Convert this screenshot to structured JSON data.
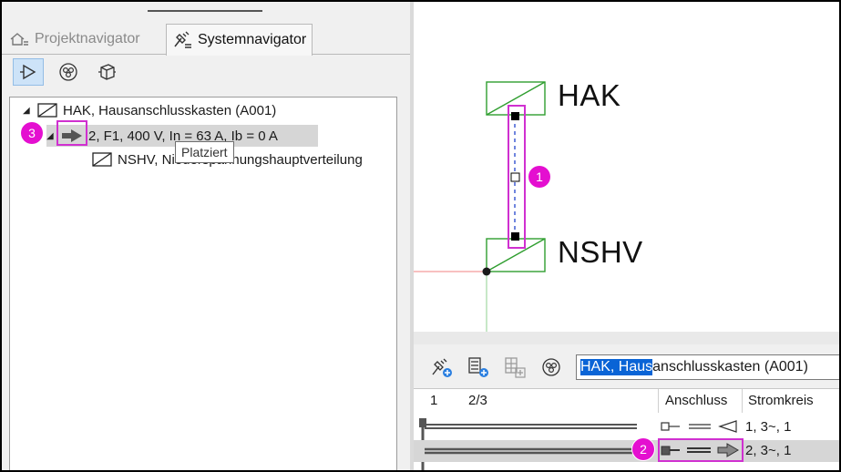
{
  "tabs": {
    "projektnavigator": "Projektnavigator",
    "systemnavigator": "Systemnavigator"
  },
  "toolbar": {
    "icons": [
      "play-outline-icon",
      "circuit-circles-icon",
      "cube-icon"
    ]
  },
  "tree": {
    "items": [
      {
        "label": "HAK, Hausanschlusskasten (A001)",
        "icon": "distribution-box-icon"
      },
      {
        "label": "2, F1, 400 V, In = 63 A, Ib = 0 A",
        "icon": "connection-arrow-icon"
      },
      {
        "label": "NSHV, Niederspannungshauptverteilung",
        "icon": "distribution-box-icon"
      }
    ],
    "tooltip": "Platziert"
  },
  "markers": {
    "m1": "1",
    "m2": "2",
    "m3": "3"
  },
  "canvas": {
    "top_label": "HAK",
    "bottom_label": "NSHV"
  },
  "bottom": {
    "search_selected": "HAK, Haus",
    "search_rest": "anschlusskasten (A001)",
    "columns": {
      "col1": "1",
      "col2": "2/3",
      "anschluss": "Anschluss",
      "stromkreis": "Stromkreis"
    },
    "rows": [
      {
        "stromkreis": "1, 3~, 1"
      },
      {
        "stromkreis": "2, 3~, 1"
      }
    ]
  },
  "colors": {
    "accent_marker": "#e40fd0",
    "selection": "#0a64d6",
    "diagram_green": "#2f9e2f"
  }
}
